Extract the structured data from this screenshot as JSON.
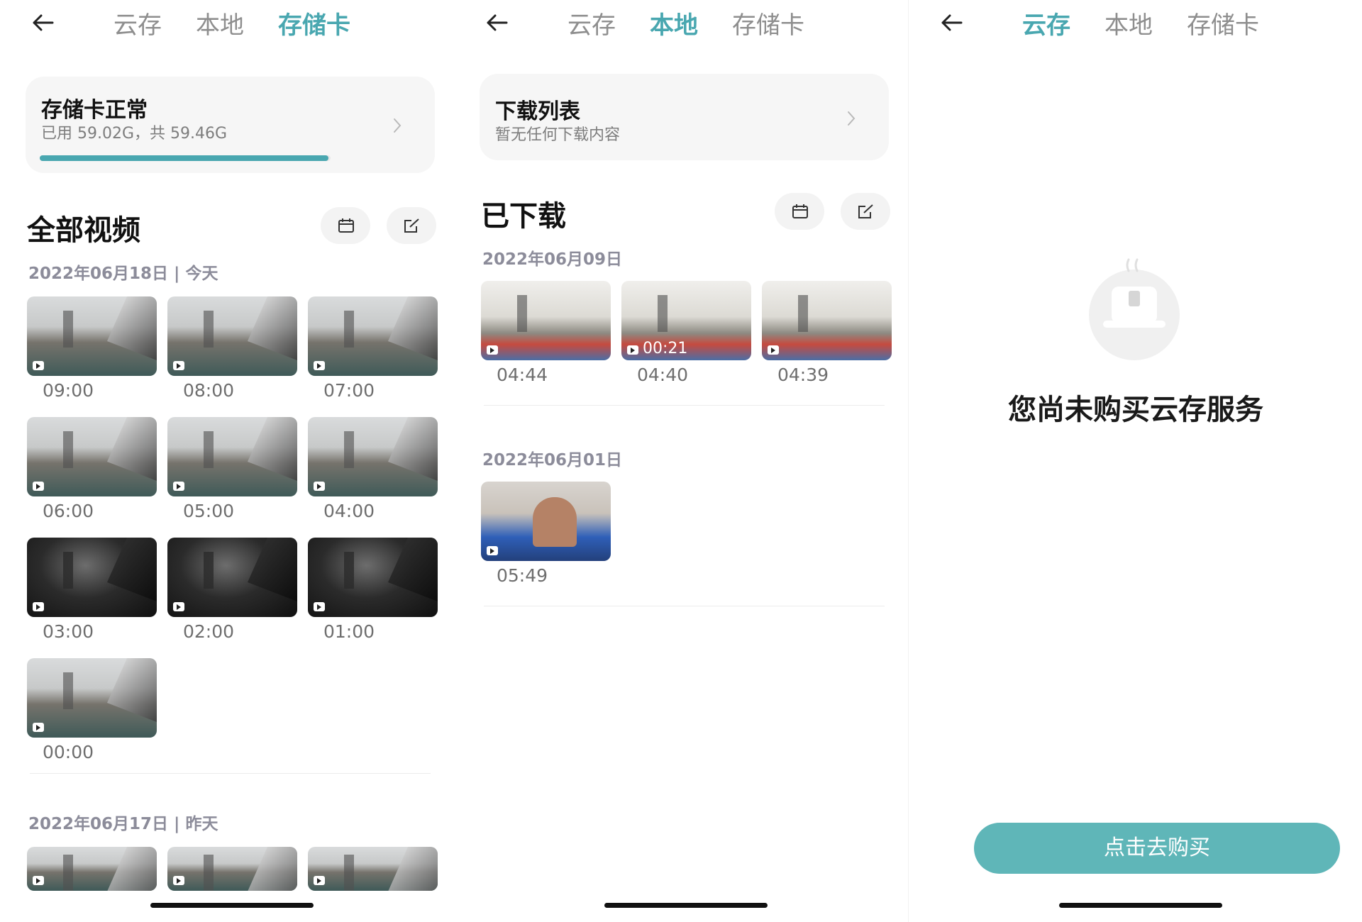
{
  "tabs": {
    "cloud": "云存",
    "local": "本地",
    "sdcard": "存储卡"
  },
  "accent_color": "#49a7b0",
  "sd": {
    "card": {
      "title": "存储卡正常",
      "usage": "已用 59.02G，共 59.46G",
      "used_fraction": 0.9926
    },
    "section_title": "全部视频",
    "groups": [
      {
        "date": "2022年06月18日 | 今天",
        "videos": [
          {
            "time": "09:00",
            "scene": "day"
          },
          {
            "time": "08:00",
            "scene": "day"
          },
          {
            "time": "07:00",
            "scene": "day"
          },
          {
            "time": "06:00",
            "scene": "day"
          },
          {
            "time": "05:00",
            "scene": "day"
          },
          {
            "time": "04:00",
            "scene": "day"
          },
          {
            "time": "03:00",
            "scene": "night"
          },
          {
            "time": "02:00",
            "scene": "night"
          },
          {
            "time": "01:00",
            "scene": "night"
          },
          {
            "time": "00:00",
            "scene": "day"
          }
        ]
      },
      {
        "date": "2022年06月17日 | 昨天",
        "videos": [
          {
            "time": "",
            "scene": "day"
          },
          {
            "time": "",
            "scene": "day"
          },
          {
            "time": "",
            "scene": "day"
          }
        ]
      }
    ]
  },
  "local": {
    "card": {
      "title": "下载列表",
      "subtitle": "暂无任何下载内容"
    },
    "section_title": "已下载",
    "groups": [
      {
        "date": "2022年06月09日",
        "videos": [
          {
            "time": "04:44",
            "scene": "living",
            "duration": ""
          },
          {
            "time": "04:40",
            "scene": "living",
            "duration": "00:21"
          },
          {
            "time": "04:39",
            "scene": "living",
            "duration": ""
          }
        ]
      },
      {
        "date": "2022年06月01日",
        "videos": [
          {
            "time": "05:49",
            "scene": "person",
            "duration": ""
          }
        ]
      }
    ]
  },
  "cloud": {
    "empty_message": "您尚未购买云存服务",
    "buy_button": "点击去购买"
  }
}
